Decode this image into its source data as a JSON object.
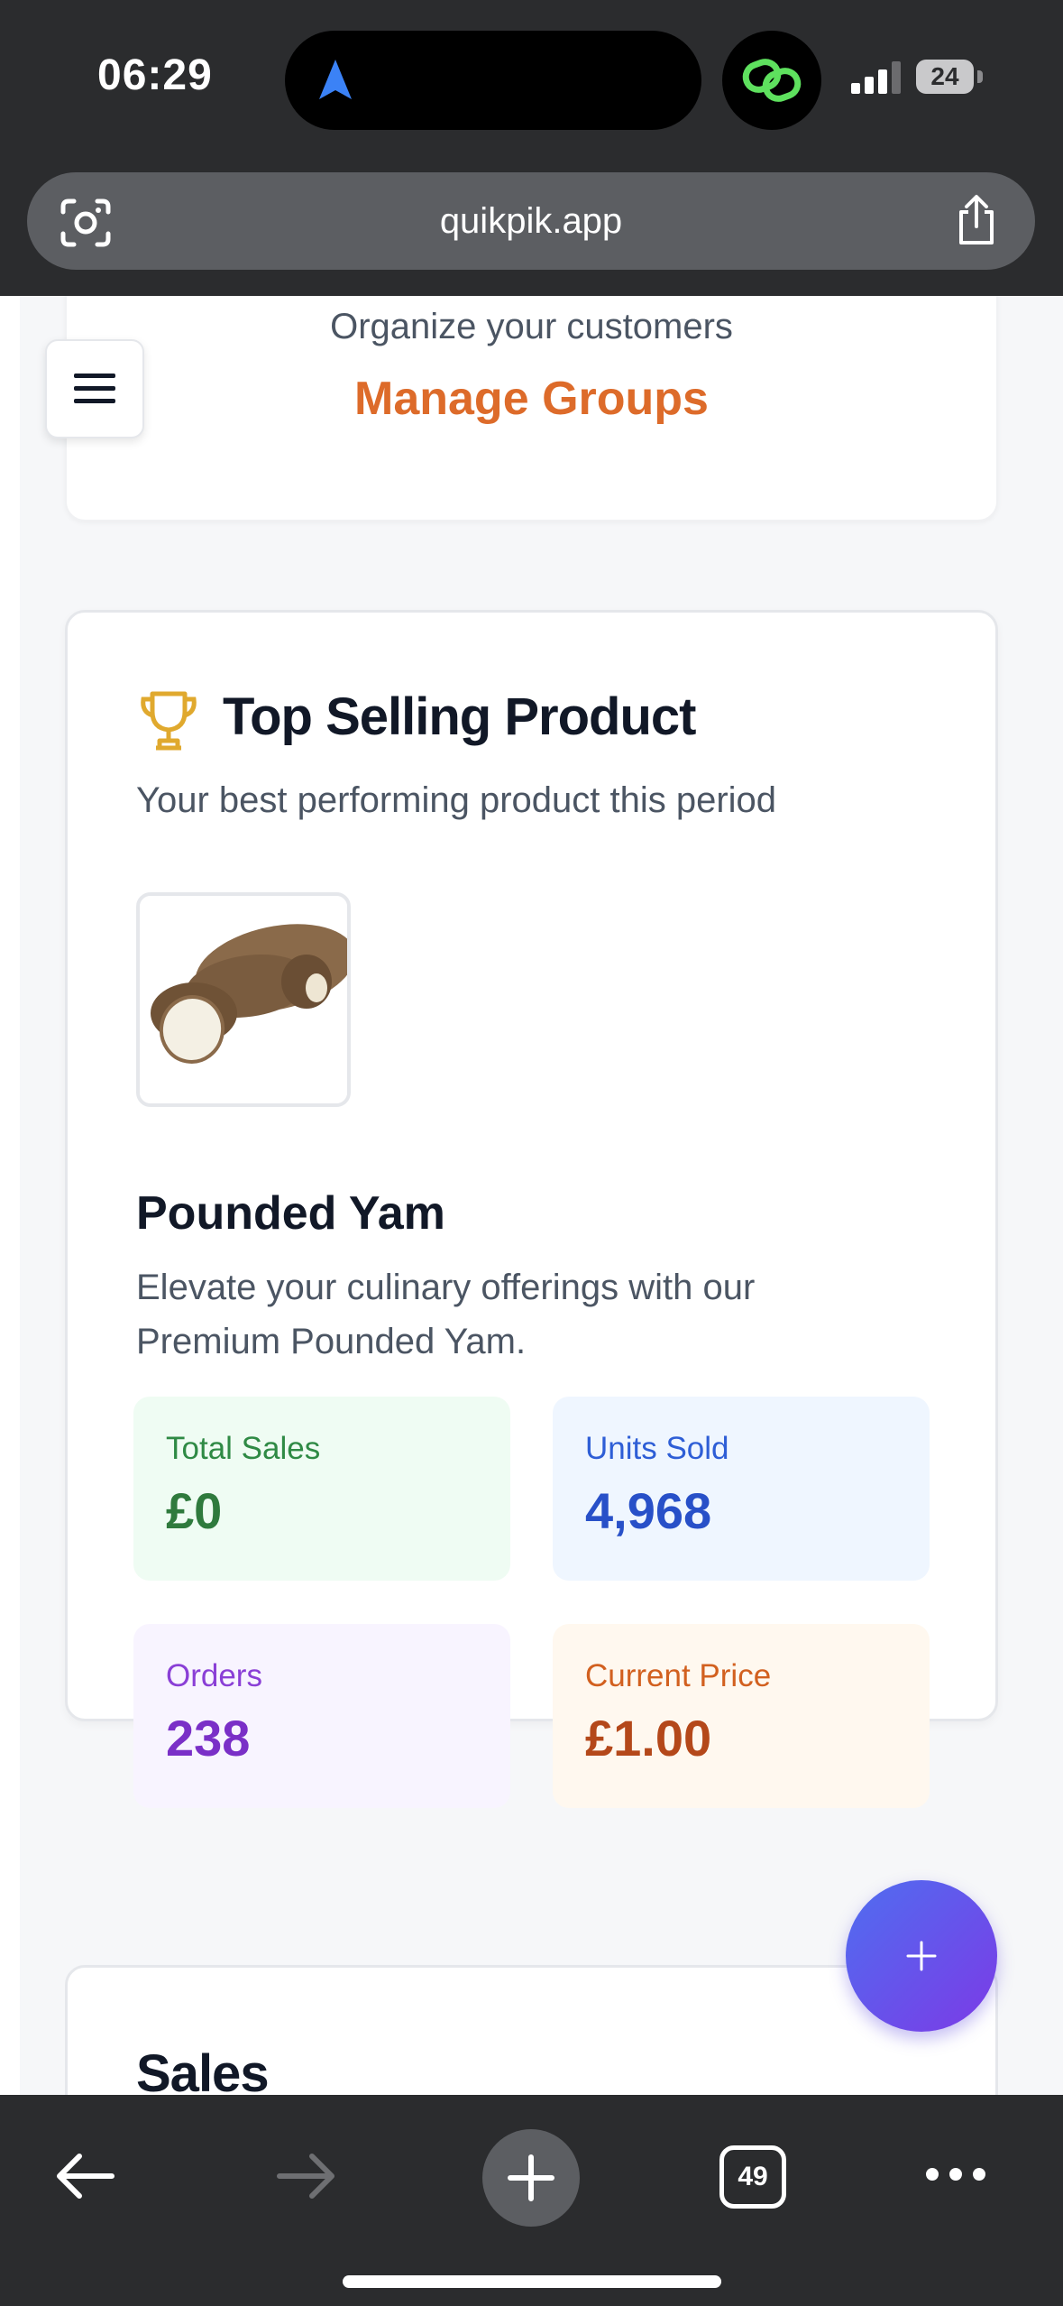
{
  "status_bar": {
    "time": "06:29",
    "battery": "24"
  },
  "browser": {
    "url": "quikpik.app",
    "tab_count": "49"
  },
  "groups_card": {
    "subtitle": "Organize your customers",
    "link": "Manage Groups"
  },
  "top_product": {
    "title": "Top Selling Product",
    "subtitle": "Your best performing product this period",
    "product_name": "Pounded Yam",
    "description": "Elevate your culinary offerings with our Premium Pounded Yam.",
    "stats": {
      "total_sales": {
        "label": "Total Sales",
        "value": "£0"
      },
      "units_sold": {
        "label": "Units Sold",
        "value": "4,968"
      },
      "orders": {
        "label": "Orders",
        "value": "238"
      },
      "current_price": {
        "label": "Current Price",
        "value": "£1.00"
      }
    }
  },
  "sales_card": {
    "title": "Sales"
  },
  "fab": {
    "label": "+"
  },
  "colors": {
    "accent_orange": "#dd6b2a",
    "green_text": "#2f8a45",
    "blue_text": "#2850c8",
    "purple_text": "#7a2fc7",
    "orange_text": "#c2521c",
    "fab_gradient_start": "#4f6ef0",
    "fab_gradient_end": "#7c3ae6"
  },
  "icons": {
    "status": [
      "navigation-arrow-icon",
      "link-icon",
      "signal-icon",
      "battery-icon"
    ],
    "browser": [
      "visual-search-icon",
      "share-icon",
      "back-icon",
      "forward-icon",
      "new-tab-icon",
      "tabs-icon",
      "more-icon"
    ],
    "page": [
      "hamburger-menu-icon",
      "trophy-icon",
      "plus-icon"
    ]
  }
}
